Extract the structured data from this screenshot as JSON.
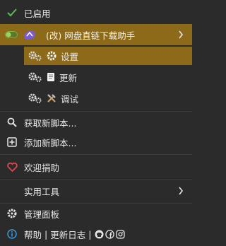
{
  "menu": {
    "enabled_label": "已启用",
    "script": {
      "name": "(改) 网盘直链下载助手",
      "sub_items": [
        {
          "label": "设置",
          "icon": "gear-icon"
        },
        {
          "label": "更新",
          "icon": "document-icon"
        },
        {
          "label": "调试",
          "icon": "tools-icon"
        }
      ]
    },
    "find_scripts": "获取新脚本...",
    "add_script": "添加新脚本...",
    "donate": "欢迎捐助",
    "utilities": "实用工具",
    "dashboard": "管理面板",
    "footer": {
      "help": "帮助",
      "separator": "|",
      "changelog": "更新日志",
      "separator2": "|"
    }
  },
  "colors": {
    "background": "#2b2b2b",
    "highlight": "#8c6a1a",
    "check_green": "#5cb85c",
    "heart_red": "#e04848",
    "info_blue": "#3a9ad9",
    "script_icon_purple": "#7b5cd6"
  }
}
